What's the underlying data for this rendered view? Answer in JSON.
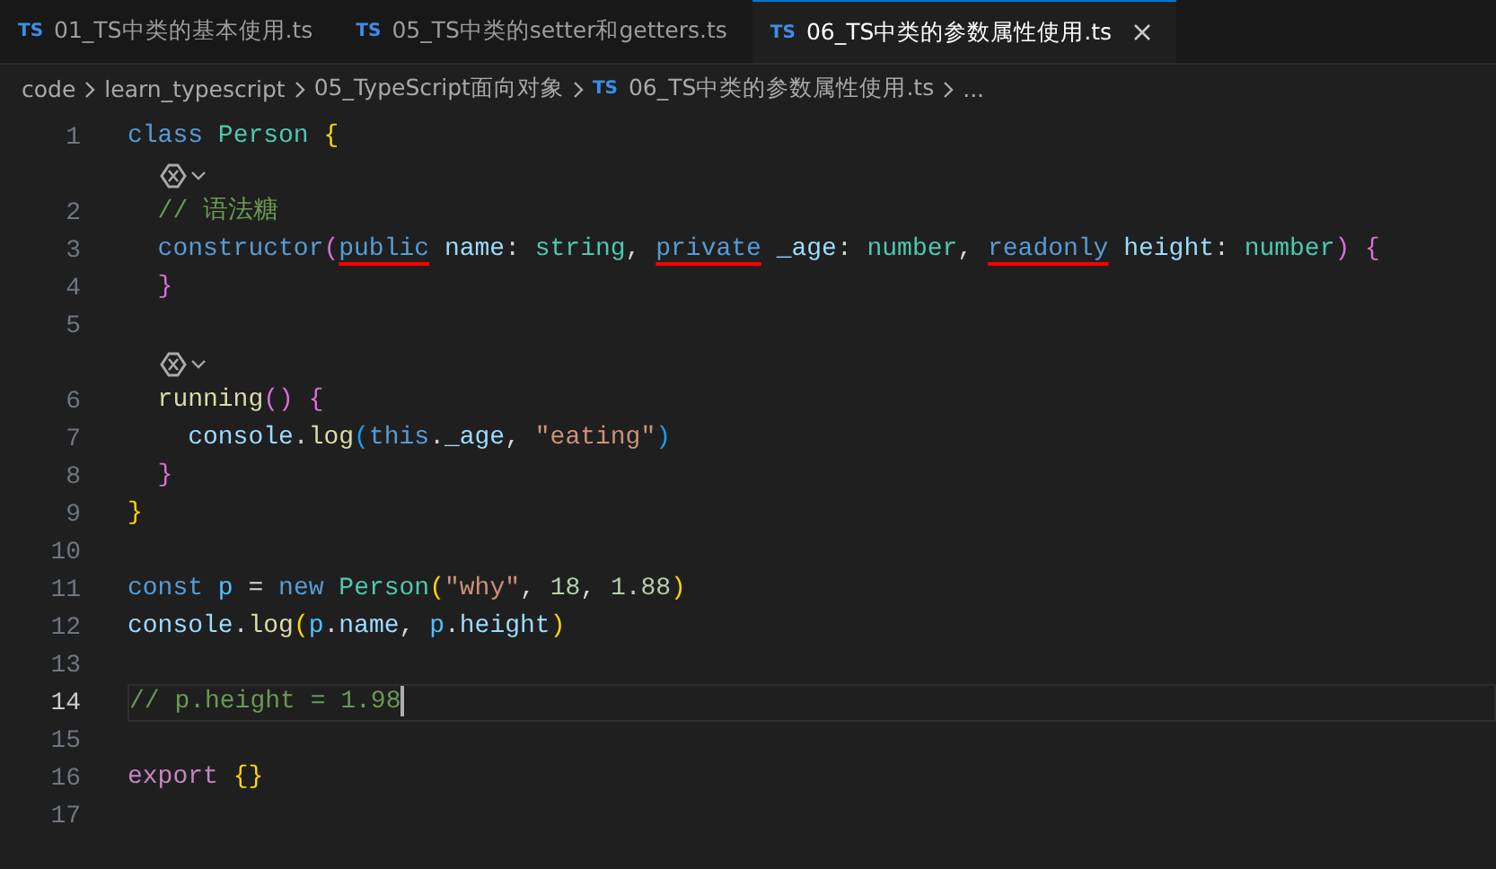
{
  "tabs": [
    {
      "badge": "TS",
      "label": "01_TS中类的基本使用.ts",
      "selected": false
    },
    {
      "badge": "TS",
      "label": "05_TS中类的setter和getters.ts",
      "selected": false
    },
    {
      "badge": "TS",
      "label": "06_TS中类的参数属性使用.ts",
      "selected": true
    }
  ],
  "breadcrumb": [
    {
      "label": "code"
    },
    {
      "label": "learn_typescript"
    },
    {
      "label": "05_TypeScript面向对象"
    },
    {
      "badge": "TS",
      "label": "06_TS中类的参数属性使用.ts"
    },
    {
      "label": "..."
    }
  ],
  "lines": [
    {
      "kind": "code",
      "number": "1",
      "current": false,
      "tokens": [
        {
          "text": "class",
          "kind": "keyword"
        },
        {
          "text": " Person",
          "kind": "type"
        },
        {
          "text": " {",
          "kind": "bracket1"
        }
      ]
    },
    {
      "kind": "lens"
    },
    {
      "kind": "code",
      "number": "2",
      "current": false,
      "tokens": [
        {
          "text": "  // 语法糖",
          "kind": "comment"
        }
      ]
    },
    {
      "kind": "code",
      "number": "3",
      "current": false,
      "tokens": [
        {
          "text": "  constructor",
          "kind": "keyword"
        },
        {
          "text": "(",
          "kind": "bracket2"
        },
        {
          "text": "public",
          "kind": "keyword",
          "marked": true
        },
        {
          "text": " name",
          "kind": "variable"
        },
        {
          "text": ": "
        },
        {
          "text": "string",
          "kind": "type"
        },
        {
          "text": ", "
        },
        {
          "text": "private",
          "kind": "keyword",
          "marked": true
        },
        {
          "text": " _age",
          "kind": "variable"
        },
        {
          "text": ": "
        },
        {
          "text": "number",
          "kind": "type"
        },
        {
          "text": ", "
        },
        {
          "text": "readonly",
          "kind": "keyword",
          "marked": true
        },
        {
          "text": " height",
          "kind": "variable"
        },
        {
          "text": ": "
        },
        {
          "text": "number",
          "kind": "type"
        },
        {
          "text": ")",
          "kind": "bracket2"
        },
        {
          "text": " {",
          "kind": "bracket2"
        }
      ]
    },
    {
      "kind": "code",
      "number": "4",
      "current": false,
      "tokens": [
        {
          "text": "  }",
          "kind": "bracket2"
        }
      ]
    },
    {
      "kind": "code",
      "number": "5",
      "current": false
    },
    {
      "kind": "lens"
    },
    {
      "kind": "code",
      "number": "6",
      "current": false,
      "tokens": [
        {
          "text": "  running",
          "kind": "function"
        },
        {
          "text": "()",
          "kind": "bracket2"
        },
        {
          "text": " {",
          "kind": "bracket2"
        }
      ]
    },
    {
      "kind": "code",
      "number": "7",
      "current": false,
      "tokens": [
        {
          "text": "    console",
          "kind": "variable"
        },
        {
          "text": "."
        },
        {
          "text": "log",
          "kind": "function"
        },
        {
          "text": "(",
          "kind": "bracket3"
        },
        {
          "text": "this",
          "kind": "keyword"
        },
        {
          "text": "."
        },
        {
          "text": "_age",
          "kind": "variable"
        },
        {
          "text": ", "
        },
        {
          "text": "\"eating\"",
          "kind": "string"
        },
        {
          "text": ")",
          "kind": "bracket3"
        }
      ]
    },
    {
      "kind": "code",
      "number": "8",
      "current": false,
      "tokens": [
        {
          "text": "  }",
          "kind": "bracket2"
        }
      ]
    },
    {
      "kind": "code",
      "number": "9",
      "current": false,
      "tokens": [
        {
          "text": "}",
          "kind": "bracket1"
        }
      ]
    },
    {
      "kind": "code",
      "number": "10",
      "current": false
    },
    {
      "kind": "code",
      "number": "11",
      "current": false,
      "tokens": [
        {
          "text": "const",
          "kind": "keyword"
        },
        {
          "text": " p",
          "kind": "constant"
        },
        {
          "text": " = "
        },
        {
          "text": "new",
          "kind": "keyword"
        },
        {
          "text": " Person",
          "kind": "type"
        },
        {
          "text": "(",
          "kind": "bracket1"
        },
        {
          "text": "\"why\"",
          "kind": "string"
        },
        {
          "text": ", "
        },
        {
          "text": "18",
          "kind": "number"
        },
        {
          "text": ", "
        },
        {
          "text": "1.88",
          "kind": "number"
        },
        {
          "text": ")",
          "kind": "bracket1"
        }
      ]
    },
    {
      "kind": "code",
      "number": "12",
      "current": false,
      "tokens": [
        {
          "text": "console",
          "kind": "variable"
        },
        {
          "text": "."
        },
        {
          "text": "log",
          "kind": "function"
        },
        {
          "text": "(",
          "kind": "bracket1"
        },
        {
          "text": "p",
          "kind": "constant"
        },
        {
          "text": "."
        },
        {
          "text": "name",
          "kind": "variable"
        },
        {
          "text": ", "
        },
        {
          "text": "p",
          "kind": "constant"
        },
        {
          "text": "."
        },
        {
          "text": "height",
          "kind": "variable"
        },
        {
          "text": ")",
          "kind": "bracket1"
        }
      ]
    },
    {
      "kind": "code",
      "number": "13",
      "current": false
    },
    {
      "kind": "code",
      "number": "14",
      "current": true,
      "tokens": [
        {
          "text": "// p.height = 1.98",
          "kind": "comment"
        }
      ]
    },
    {
      "kind": "code",
      "number": "15",
      "current": false
    },
    {
      "kind": "code",
      "number": "16",
      "current": false,
      "tokens": [
        {
          "text": "export",
          "kind": "control"
        },
        {
          "text": " {}",
          "kind": "bracket1"
        }
      ]
    },
    {
      "kind": "code",
      "number": "17",
      "current": false
    }
  ]
}
